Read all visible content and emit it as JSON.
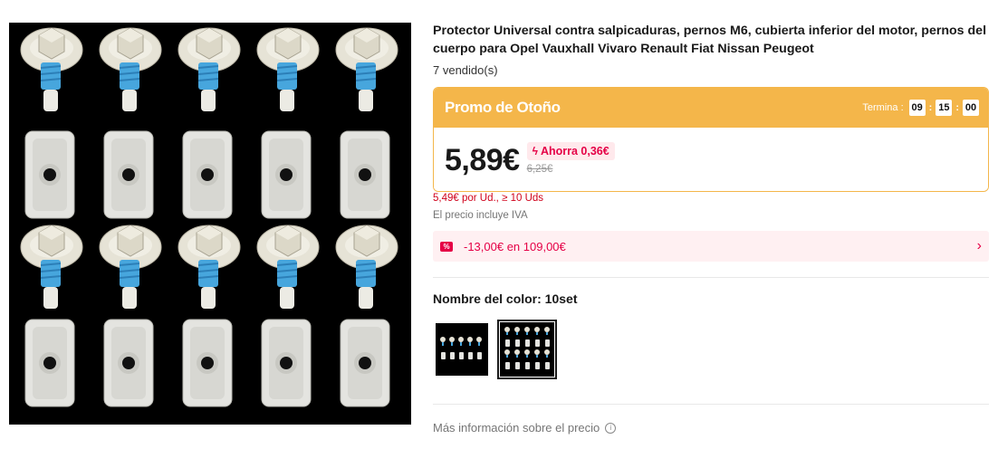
{
  "product": {
    "title": "Protector Universal contra salpicaduras, pernos M6, cubierta inferior del motor, pernos del cuerpo para Opel Vauxhall Vivaro Renault Fiat Nissan Peugeot",
    "sold": "7 vendido(s)"
  },
  "promo": {
    "name": "Promo de Otoño",
    "ends_label": "Termina :",
    "timer": {
      "hours": "09",
      "minutes": "15",
      "seconds": "00"
    },
    "price": "5,89€",
    "save": "Ahorra 0,36€",
    "old_price": "6,25€"
  },
  "bulk_price": "5,49€ por Ud., ≥ 10 Uds",
  "vat_note": "El precio incluye IVA",
  "coupon": {
    "icon": "%",
    "text": "-13,00€ en 109,00€"
  },
  "color": {
    "label": "Nombre del color: 10set"
  },
  "more_info": "Más información sobre el precio",
  "colors": {
    "accent": "#f4b64a",
    "sale": "#e50046"
  }
}
